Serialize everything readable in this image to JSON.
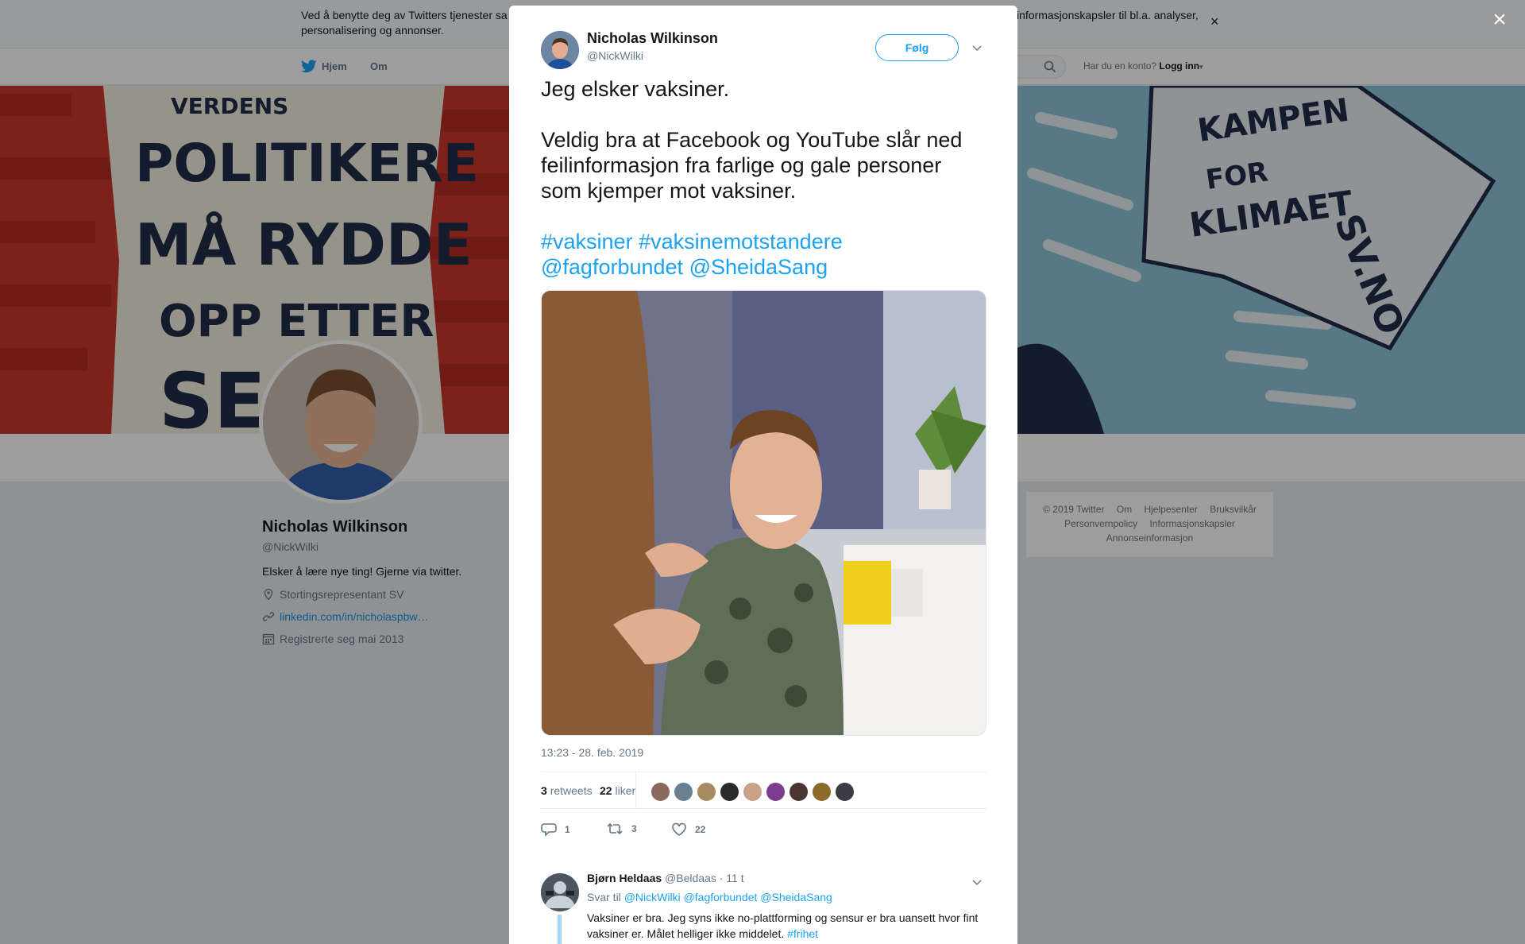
{
  "cookie_bar": {
    "text_left": "Ved å benytte deg av Twitters tjenester sa",
    "text_line2": "personalisering og annonser.",
    "text_right": "informasjonskapsler til bl.a. analyser,",
    "close_label": "×"
  },
  "nav": {
    "home_label": "Hjem",
    "about_label": "Om",
    "login_prompt": "Har du en konto?",
    "login_label": "Logg inn"
  },
  "profile": {
    "name": "Nicholas Wilkinson",
    "handle": "@NickWilki",
    "bio": "Elsker å lære nye ting! Gjerne via twitter.",
    "location": "Stortingsrepresentant SV",
    "website": "linkedin.com/in/nicholaspbw…",
    "joined": "Registrerte seg mai 2013"
  },
  "footer": {
    "links_row1": [
      "© 2019 Twitter",
      "Om",
      "Hjelpesenter",
      "Bruksvilkår"
    ],
    "links_row2": [
      "Personvernpolicy",
      "Informasjonskapsler"
    ],
    "links_row3": [
      "Annonseinformasjon"
    ]
  },
  "modal_close_label": "×",
  "tweet": {
    "author_name": "Nicholas Wilkinson",
    "author_handle": "@NickWilki",
    "follow_label": "Følg",
    "line1": "Jeg elsker vaksiner.",
    "line2": "Veldig bra at Facebook og YouTube slår ned feilinformasjon fra farlige og gale personer som kjemper mot vaksiner.",
    "tags": [
      "#vaksiner",
      "#vaksinemotstandere",
      "@fagforbundet",
      "@SheidaSang"
    ],
    "timestamp": "13:23 - 28. feb. 2019",
    "retweets_count": "3",
    "retweets_label": "retweets",
    "likes_count": "22",
    "likes_label": "liker",
    "reply_count": "1",
    "retweet_action_count": "3",
    "like_action_count": "22"
  },
  "reply": {
    "author_name": "Bjørn Heldaas",
    "author_handle": "@Beldaas",
    "time": "· 11 t",
    "reply_to_prefix": "Svar til",
    "reply_to": [
      "@NickWilki",
      "@fagforbundet",
      "@SheidaSang"
    ],
    "body": "Vaksiner er bra. Jeg syns ikke no-plattforming og sensur er bra uansett hvor fint vaksiner er. Målet helliger ikke middelet.",
    "hashtag": "#frihet"
  },
  "colors": {
    "twitter_blue": "#1da1f2",
    "link_blue": "#1b95e0",
    "text_dark": "#14171a",
    "text_gray": "#657786"
  }
}
